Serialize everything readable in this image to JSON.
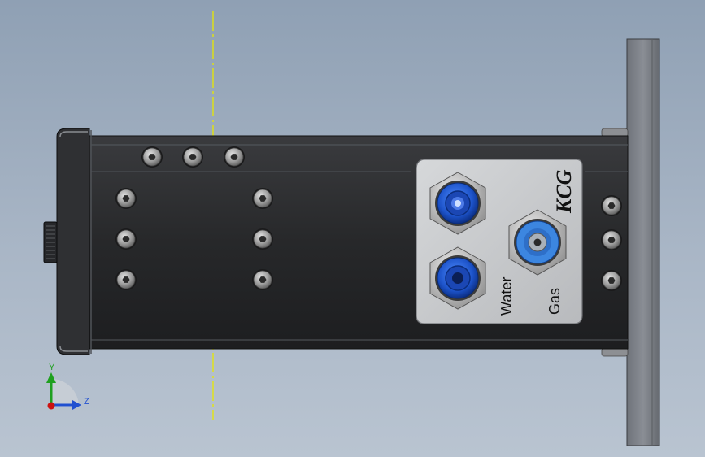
{
  "viewport": {
    "background_top": "#8fa0b4",
    "background_bottom": "#b9c4d1",
    "centerline_color": "#e8e800"
  },
  "part": {
    "body_color": "#2b2c2e",
    "flange_color": "#7b7f86",
    "plate_color": "#c8cacc",
    "fitting_color": "#1f63d8",
    "brand_label": "KCG",
    "water_label": "Water",
    "gas_label": "Gas"
  },
  "triad": {
    "y_label": "Y",
    "z_label": "Z",
    "y_color": "#1fa01f",
    "z_color": "#2050d0",
    "x_color": "#cc1111"
  }
}
